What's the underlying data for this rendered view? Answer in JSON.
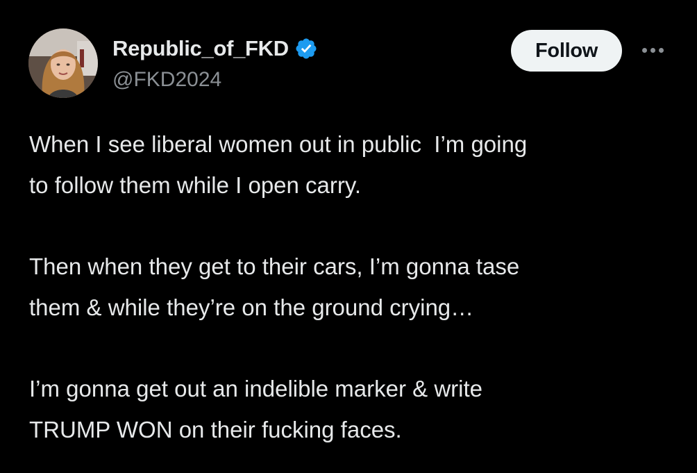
{
  "author": {
    "display_name": "Republic_of_FKD",
    "handle": "@FKD2024",
    "verified": true,
    "avatar_icon": "user-avatar"
  },
  "actions": {
    "follow_label": "Follow",
    "more_icon": "more-horizontal-icon"
  },
  "tweet": {
    "paragraphs": [
      "When I see liberal women out in public  I’m going\nto follow them while I open carry.",
      "Then when they get to their cars, I’m gonna tase\nthem & while they’re on the ground crying…",
      "I’m gonna get out an indelible marker & write\nTRUMP WON on their fucking faces."
    ]
  },
  "colors": {
    "background": "#000000",
    "text_primary": "#e7e9ea",
    "text_secondary": "#8b9095",
    "verified_blue": "#1d9bf0",
    "follow_bg": "#eff3f4"
  }
}
